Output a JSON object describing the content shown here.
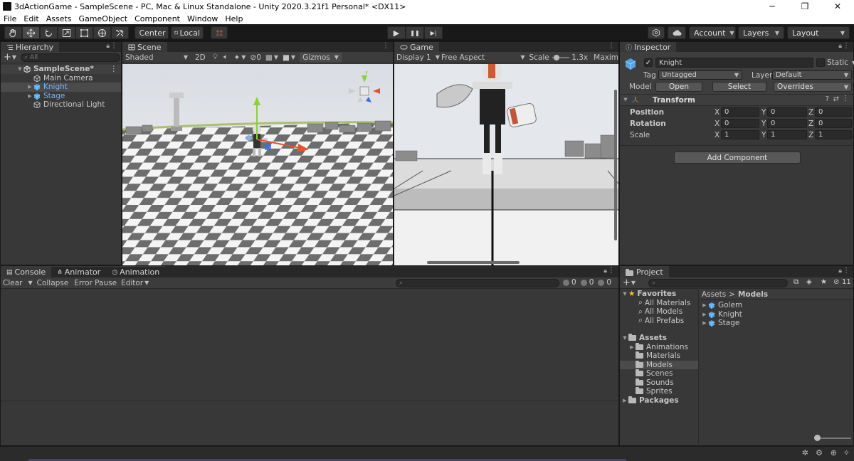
{
  "window": {
    "title": "3dActionGame - SampleScene - PC, Mac & Linux Standalone - Unity 2020.3.21f1 Personal* <DX11>",
    "minimize": "─",
    "restore": "❐",
    "close": "✕"
  },
  "menu": [
    "File",
    "Edit",
    "Assets",
    "GameObject",
    "Component",
    "Window",
    "Help"
  ],
  "toolbar": {
    "tools": [
      "hand-tool",
      "move-tool",
      "rotate-tool",
      "scale-tool",
      "rect-tool",
      "transform-tool",
      "custom-tool"
    ],
    "pivot_mode": "Center",
    "pivot_rotation": "Local",
    "play": "▶",
    "pause": "❚❚",
    "step": "▶|",
    "account": "Account",
    "layers": "Layers",
    "layout": "Layout"
  },
  "hierarchy": {
    "tab": "Hierarchy",
    "add": "+",
    "search_placeholder": "All",
    "scene": "SampleScene*",
    "items": [
      {
        "label": "Main Camera",
        "expandable": false,
        "selected": false,
        "prefab": false
      },
      {
        "label": "Knight",
        "expandable": true,
        "selected": true,
        "prefab": true
      },
      {
        "label": "Stage",
        "expandable": true,
        "selected": false,
        "prefab": true
      },
      {
        "label": "Directional Light",
        "expandable": false,
        "selected": false,
        "prefab": false
      }
    ]
  },
  "scene": {
    "tab": "Scene",
    "shading": "Shaded",
    "mode2d": "2D",
    "hidden_count": "0",
    "gizmos": "Gizmos"
  },
  "game": {
    "tab": "Game",
    "display": "Display 1",
    "aspect": "Free Aspect",
    "scale_label": "Scale",
    "scale_value": "1.3x",
    "maximize": "Maxim"
  },
  "inspector": {
    "tab": "Inspector",
    "object_name": "Knight",
    "static_label": "Static",
    "tag_label": "Tag",
    "tag_value": "Untagged",
    "layer_label": "Layer",
    "layer_value": "Default",
    "model_label": "Model",
    "open": "Open",
    "select": "Select",
    "overrides": "Overrides",
    "transform": {
      "title": "Transform",
      "rows": [
        {
          "label": "Position",
          "x": "0",
          "y": "0",
          "z": "0"
        },
        {
          "label": "Rotation",
          "x": "0",
          "y": "0",
          "z": "0"
        },
        {
          "label": "Scale",
          "x": "1",
          "y": "1",
          "z": "1"
        }
      ],
      "axis_x": "X",
      "axis_y": "Y",
      "axis_z": "Z"
    },
    "add_component": "Add Component"
  },
  "console": {
    "tabs": [
      "Console",
      "Animator",
      "Animation"
    ],
    "clear": "Clear",
    "collapse": "Collapse",
    "error_pause": "Error Pause",
    "editor": "Editor",
    "count_log": "0",
    "count_warn": "0",
    "count_error": "0"
  },
  "project": {
    "tab": "Project",
    "add": "+",
    "hidden_count": "11",
    "favorites": "Favorites",
    "favorite_items": [
      "All Materials",
      "All Models",
      "All Prefabs"
    ],
    "assets": "Assets",
    "asset_folders": [
      {
        "label": "Animations",
        "expandable": true,
        "selected": false
      },
      {
        "label": "Materials",
        "expandable": false,
        "selected": false
      },
      {
        "label": "Models",
        "expandable": false,
        "selected": true
      },
      {
        "label": "Scenes",
        "expandable": false,
        "selected": false
      },
      {
        "label": "Sounds",
        "expandable": false,
        "selected": false
      },
      {
        "label": "Sprites",
        "expandable": false,
        "selected": false
      }
    ],
    "packages": "Packages",
    "breadcrumb": [
      "Assets",
      "Models"
    ],
    "breadcrumb_sep": ">",
    "models": [
      "Golem",
      "Knight",
      "Stage"
    ]
  },
  "colors": {
    "accent_blue": "#7cb3f2",
    "panel": "#383838",
    "prefab_cube": "#4fa3e6"
  }
}
